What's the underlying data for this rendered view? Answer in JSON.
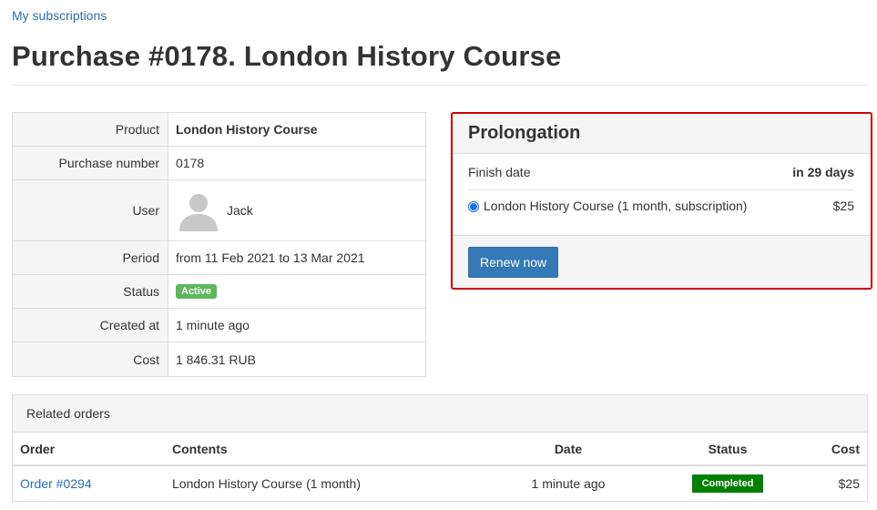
{
  "breadcrumb": "My subscriptions",
  "page_title": "Purchase #0178. London History Course",
  "details": {
    "product_label": "Product",
    "product_value": "London History Course",
    "purchase_number_label": "Purchase number",
    "purchase_number_value": "0178",
    "user_label": "User",
    "user_name": "Jack",
    "period_label": "Period",
    "period_value": "from 11 Feb 2021 to 13 Mar 2021",
    "status_label": "Status",
    "status_value": "Active",
    "created_label": "Created at",
    "created_value": "1 minute ago",
    "cost_label": "Cost",
    "cost_value": "1 846.31 RUB"
  },
  "prolongation": {
    "title": "Prolongation",
    "finish_date_label": "Finish date",
    "finish_date_value": "in 29 days",
    "option_label": "London History Course (1 month, subscription)",
    "option_price": "$25",
    "renew_label": "Renew now"
  },
  "related_orders": {
    "title": "Related orders",
    "columns": {
      "order": "Order",
      "contents": "Contents",
      "date": "Date",
      "status": "Status",
      "cost": "Cost"
    },
    "rows": [
      {
        "order": "Order #0294",
        "contents": "London History Course (1 month)",
        "date": "1 minute ago",
        "status": "Completed",
        "cost": "$25"
      }
    ]
  },
  "colors": {
    "link": "#2a6fb0",
    "active_badge": "#5cb85c",
    "completed_badge": "#008000",
    "primary_button": "#337ab7",
    "highlight_border": "#cc0000"
  }
}
